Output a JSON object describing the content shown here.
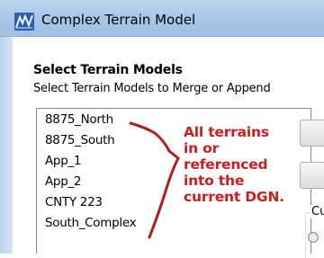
{
  "window": {
    "title": "Complex Terrain Model",
    "icon": "microstation-app-icon"
  },
  "section": {
    "heading": "Select Terrain Models",
    "description": "Select Terrain Models to Merge or Append"
  },
  "terrain_list": {
    "items": [
      {
        "label": "8875_North"
      },
      {
        "label": "8875_South"
      },
      {
        "label": "App_1"
      },
      {
        "label": "App_2"
      },
      {
        "label": "CNTY 223"
      },
      {
        "label": "South_Complex"
      }
    ]
  },
  "right_panel": {
    "group_label": "Cu"
  },
  "annotation": {
    "lines": [
      "All terrains",
      "in or",
      "referenced",
      "into the",
      "current DGN."
    ],
    "color": "#d01c1c"
  }
}
